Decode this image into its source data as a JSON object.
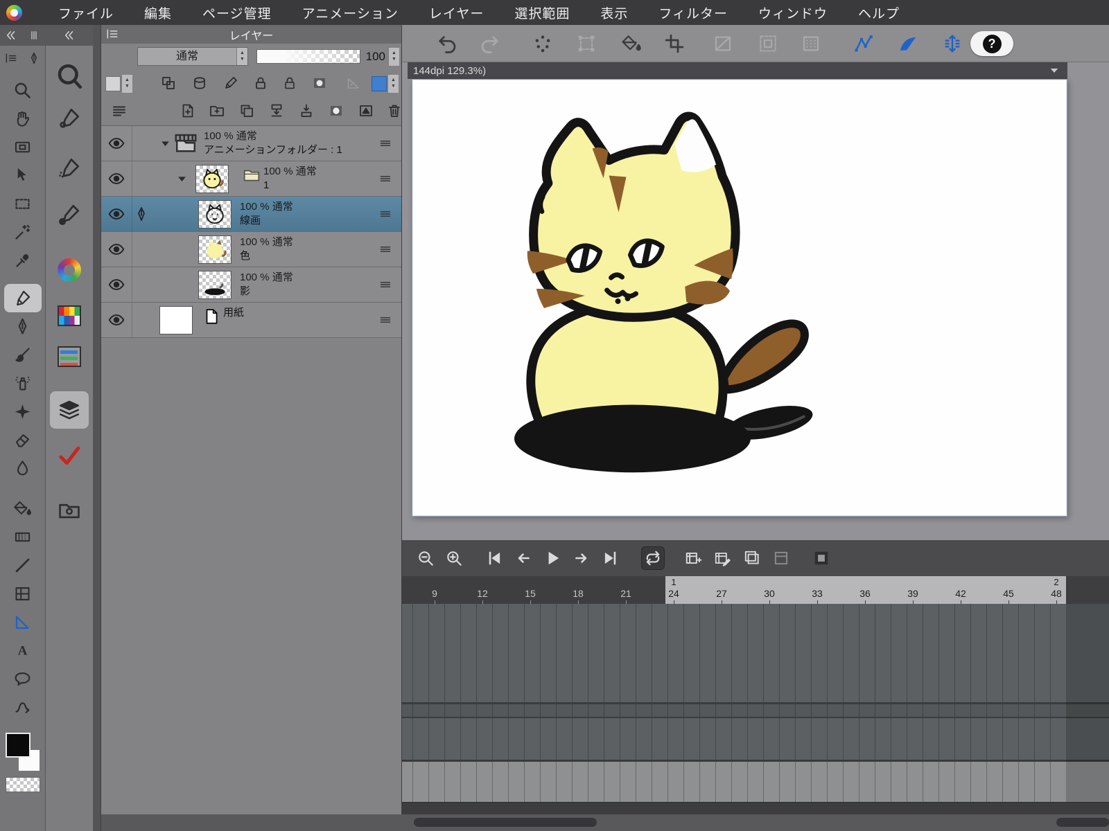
{
  "colors": {
    "accent_blue": "#1e63c8",
    "selected_layer": "#5a86a1",
    "check_red": "#c9251f",
    "cat_yellow": "#f7f3a3",
    "cat_brown": "#8f5f2b",
    "cat_outline": "#141414"
  },
  "menu_bar": {
    "items": [
      "ファイル",
      "編集",
      "ページ管理",
      "アニメーション",
      "レイヤー",
      "選択範囲",
      "表示",
      "フィルター",
      "ウィンドウ",
      "ヘルプ"
    ]
  },
  "tool_column_1": {
    "tools": [
      "zoom-tool",
      "hand-tool",
      "navigator-tool",
      "move-layer-tool",
      "marquee-select-tool",
      "auto-select-tool",
      "eyedropper-tool",
      "marker-tool",
      "pen-tool",
      "brush-tool",
      "airbrush-tool",
      "decoration-tool",
      "eraser-tool",
      "blend-tool",
      "fill-tool",
      "gradient-tool",
      "figure-tool",
      "frame-border-tool",
      "ruler-tool",
      "text-tool",
      "balloon-tool",
      "correction-line-tool"
    ],
    "selected_tool": "marker-tool",
    "swatches": [
      "main-color",
      "sub-color",
      "transparent-color"
    ]
  },
  "tool_column_2": {
    "panels": [
      "loupe",
      "subtool-panel",
      "brush-settings-panel",
      "brush-size-panel",
      "color-wheel-panel",
      "color-set-panel",
      "color-slider-panel",
      "layer-panel",
      "auto-action-panel",
      "material-panel"
    ],
    "selected_panel": "layer-panel"
  },
  "top_toolbar": {
    "buttons": [
      {
        "name": "undo",
        "state": "normal"
      },
      {
        "name": "redo",
        "state": "disabled"
      },
      {
        "name": "scatter",
        "state": "normal"
      },
      {
        "name": "transform",
        "state": "disabled"
      },
      {
        "name": "fill",
        "state": "normal"
      },
      {
        "name": "crop-frame",
        "state": "normal"
      },
      {
        "name": "quick-mask",
        "state": "disabled"
      },
      {
        "name": "selection-border",
        "state": "disabled"
      },
      {
        "name": "selection-area",
        "state": "disabled"
      },
      {
        "name": "snap-ruler",
        "state": "active"
      },
      {
        "name": "snap-special-ruler",
        "state": "active"
      },
      {
        "name": "snap-grid",
        "state": "active"
      }
    ],
    "help_label": "?"
  },
  "canvas": {
    "title": "144dpi 129.3%)"
  },
  "layer_panel": {
    "title": "レイヤー",
    "blend_mode": "通常",
    "opacity": "100",
    "property_icons": [
      {
        "name": "clipping"
      },
      {
        "name": "reference-layer"
      },
      {
        "name": "draft-layer"
      },
      {
        "name": "lock-layer"
      },
      {
        "name": "lock-transparent"
      },
      {
        "name": "enable-mask"
      },
      {
        "name": "ruler-display",
        "state": "disabled"
      }
    ],
    "toolbar_icons": [
      "layer-menu",
      "new-layer",
      "new-folder",
      "duplicate-layer",
      "transfer-down",
      "merge-down",
      "create-mask",
      "apply-mask",
      "delete-layer"
    ],
    "rows": [
      {
        "kind": "anim_folder",
        "line1": "100 % 通常",
        "name": "アニメーションフォルダー : 1",
        "selected": false
      },
      {
        "kind": "folder",
        "line1": "100 % 通常",
        "name": "1",
        "thumb": "cat-full",
        "selected": false
      },
      {
        "kind": "layer",
        "line1": "100 % 通常",
        "name": "線画",
        "thumb": "cat-line",
        "selected": true,
        "editing": true
      },
      {
        "kind": "layer",
        "line1": "100 % 通常",
        "name": "色",
        "thumb": "cat-color",
        "selected": false
      },
      {
        "kind": "layer",
        "line1": "100 % 通常",
        "name": "影",
        "thumb": "cat-shadow",
        "selected": false
      },
      {
        "kind": "paper",
        "line1": "",
        "name": "用紙",
        "thumb": "paper",
        "selected": false
      }
    ]
  },
  "timeline": {
    "controls": [
      {
        "name": "timeline-zoom-out"
      },
      {
        "name": "timeline-zoom-in"
      },
      {
        "name": "first-frame"
      },
      {
        "name": "prev-frame"
      },
      {
        "name": "play"
      },
      {
        "name": "next-frame"
      },
      {
        "name": "last-frame"
      },
      {
        "name": "loop-playback",
        "state": "active"
      },
      {
        "name": "new-cel"
      },
      {
        "name": "specify-cel"
      },
      {
        "name": "onion-skin"
      },
      {
        "name": "cel-settings",
        "state": "disabled"
      },
      {
        "name": "light-table"
      }
    ],
    "ruler": {
      "dark_frames": [
        9,
        12,
        15,
        18,
        21
      ],
      "light_frames": [
        24,
        27,
        30,
        33,
        36,
        39,
        42,
        45,
        48
      ],
      "seconds": [
        {
          "label": "1",
          "frame": 24
        },
        {
          "label": "2",
          "frame": 48
        }
      ]
    }
  }
}
